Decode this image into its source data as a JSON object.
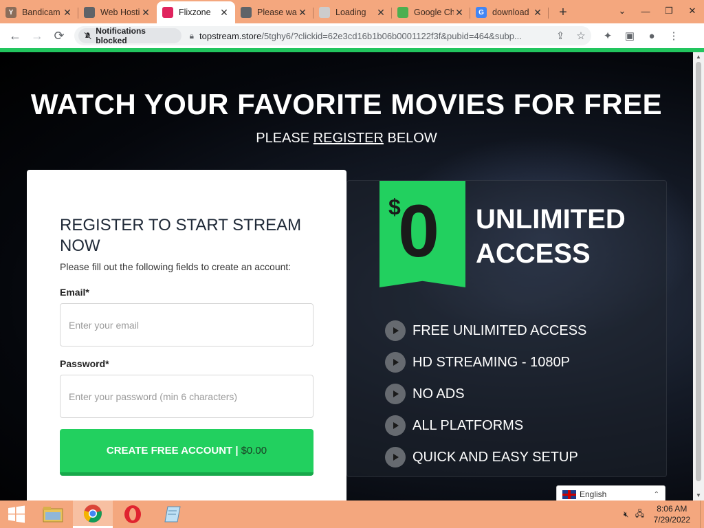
{
  "browser": {
    "tabs": [
      {
        "title": "Bandicam",
        "icon": "bandicam-icon",
        "color": "#8a6d5a",
        "glyph": "Y"
      },
      {
        "title": "Web Hosting",
        "icon": "globe-icon",
        "color": "#5f6368",
        "glyph": ""
      },
      {
        "title": "Flixzone",
        "icon": "flixzone-play-icon",
        "color": "#e0245e",
        "glyph": ""
      },
      {
        "title": "Please wait",
        "icon": "globe-icon",
        "color": "#5f6368",
        "glyph": ""
      },
      {
        "title": "Loading",
        "icon": "loading-spinner-icon",
        "color": "#cccccc",
        "glyph": ""
      },
      {
        "title": "Google Chrome",
        "icon": "leaf-icon",
        "color": "#4caf50",
        "glyph": ""
      },
      {
        "title": "download",
        "icon": "google-icon",
        "color": "#4285f4",
        "glyph": "G"
      }
    ],
    "active_tab": 2,
    "notifications_chip": "Notifications blocked",
    "url_host": "topstream.store",
    "url_path": "/5tghy6/?clickid=62e3cd16b1b06b0001122f3f&pubid=464&subp..."
  },
  "page": {
    "headline": "WATCH YOUR FAVORITE MOVIES FOR FREE",
    "sub_pre": "PLEASE ",
    "sub_link": "REGISTER",
    "sub_post": " BELOW",
    "form": {
      "title": "REGISTER TO START STREAM NOW",
      "hint": "Please fill out the following fields to create an account:",
      "email_label": "Email*",
      "email_placeholder": "Enter your email",
      "password_label": "Password*",
      "password_placeholder": "Enter your password (min 6 characters)",
      "cta_label": "CREATE FREE ACCOUNT |",
      "cta_price": "$0.00"
    },
    "offer": {
      "currency": "$",
      "amount": "0",
      "line1": "UNLIMITED",
      "line2": "ACCESS",
      "features": [
        "FREE UNLIMITED ACCESS",
        "HD STREAMING - 1080P",
        "NO ADS",
        "ALL PLATFORMS",
        "QUICK AND EASY SETUP"
      ]
    },
    "language": "English",
    "accent_color": "#22d05f"
  },
  "taskbar": {
    "time": "8:06 AM",
    "date": "7/29/2022"
  }
}
